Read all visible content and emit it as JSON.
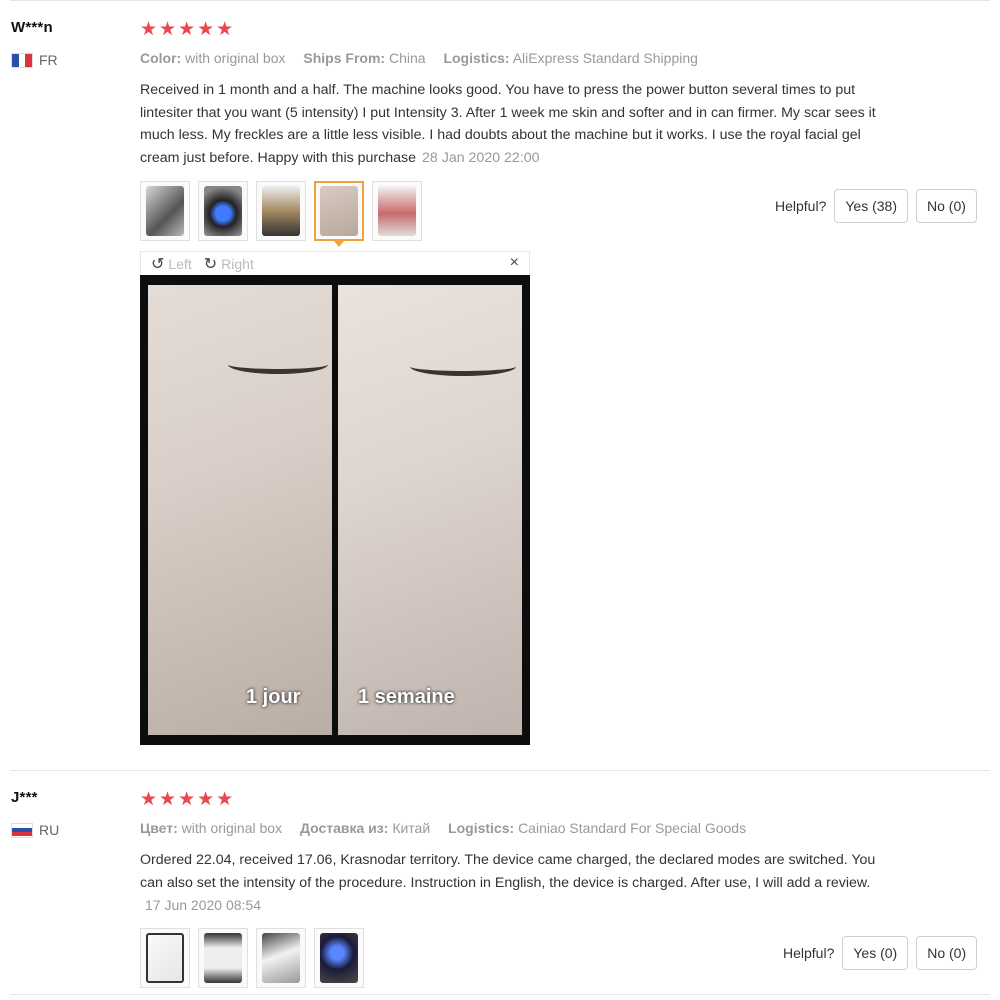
{
  "reviews": [
    {
      "name": "W***n",
      "country": "FR",
      "stars": "★★★★★",
      "meta": [
        {
          "label": "Color:",
          "value": "with original box"
        },
        {
          "label": "Ships From:",
          "value": "China"
        },
        {
          "label": "Logistics:",
          "value": "AliExpress Standard Shipping"
        }
      ],
      "text": "Received in 1 month and a half. The machine looks good. You have to press the power button several times to put lintesiter that you want (5 intensity) I put Intensity 3. After 1 week me skin and softer and in can firmer. My scar sees it much less. My freckles are a little less visible. I had doubts about the machine but it works. I use the royal facial gel cream just before. Happy with this purchase",
      "date": "28 Jan 2020 22:00",
      "helpful_label": "Helpful?",
      "yes": "Yes (38)",
      "no": "No (0)",
      "viewer": {
        "left": "Left",
        "right": "Right",
        "close": "×",
        "caption_left": "1 jour",
        "caption_right": "1 semaine"
      }
    },
    {
      "name": "J***",
      "country": "RU",
      "stars": "★★★★★",
      "meta": [
        {
          "label": "Цвет:",
          "value": "with original box"
        },
        {
          "label": "Доставка из:",
          "value": "Китай"
        },
        {
          "label": "Logistics:",
          "value": "Cainiao Standard For Special Goods"
        }
      ],
      "text": "Ordered 22.04, received 17.06, Krasnodar territory. The device came charged, the declared modes are switched. You can also set the intensity of the procedure. Instruction in English, the device is charged. After use, I will add a review.",
      "date": "17 Jun 2020 08:54",
      "helpful_label": "Helpful?",
      "yes": "Yes (0)",
      "no": "No (0)"
    }
  ],
  "colors": {
    "star": "#e8494c",
    "active_thumb": "#f0a03c",
    "meta": "#999999"
  }
}
